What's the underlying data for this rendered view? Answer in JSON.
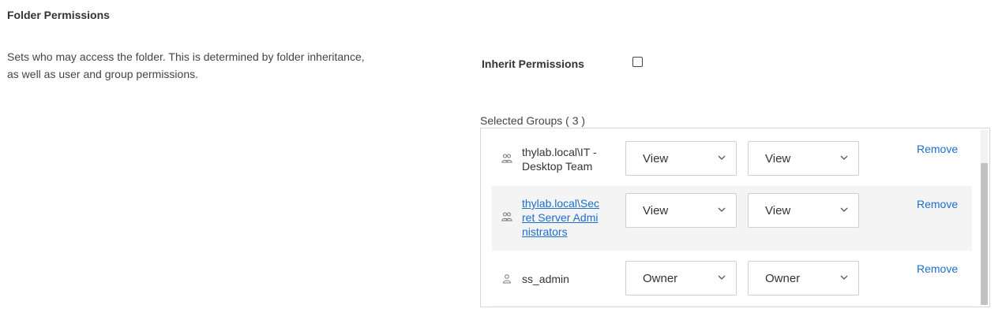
{
  "section": {
    "title": "Folder Permissions",
    "description": "Sets who may access the folder. This is determined by folder inheritance, as well as user and group permissions."
  },
  "inherit": {
    "label": "Inherit Permissions",
    "checked": false
  },
  "groups": {
    "header": "Selected Groups ( 3 )",
    "remove_label": "Remove",
    "rows": [
      {
        "icon": "group-icon",
        "name_lines": [
          "thylab.local\\IT -",
          "Desktop Team"
        ],
        "is_link": false,
        "folder_permission": "View",
        "secret_permission": "View"
      },
      {
        "icon": "group-icon",
        "name_lines": [
          "thylab.local\\Sec",
          "ret Server Admi",
          "nistrators"
        ],
        "is_link": true,
        "folder_permission": "View",
        "secret_permission": "View"
      },
      {
        "icon": "user-icon",
        "name_lines": [
          "ss_admin"
        ],
        "is_link": false,
        "folder_permission": "Owner",
        "secret_permission": "Owner"
      }
    ]
  },
  "colors": {
    "link": "#1a6fcf",
    "alt_row": "#f4f4f4",
    "border": "#d6d6d6"
  }
}
